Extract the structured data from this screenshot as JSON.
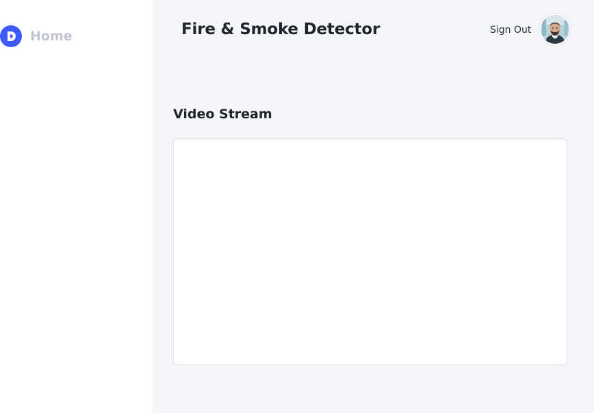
{
  "sidebar": {
    "logo": {
      "icon": "logo-d-icon",
      "letter": "D",
      "color": "#3d5afe"
    },
    "items": [
      {
        "label": "Home"
      }
    ]
  },
  "header": {
    "title": "Fire & Smoke Detector",
    "sign_out_label": "Sign Out",
    "avatar_icon": "user-avatar"
  },
  "main": {
    "section_title": "Video Stream"
  },
  "colors": {
    "accent": "#3d5afe",
    "background": "#f5f6fa",
    "sidebar": "#ffffff",
    "muted_text": "#c3c5d0"
  }
}
